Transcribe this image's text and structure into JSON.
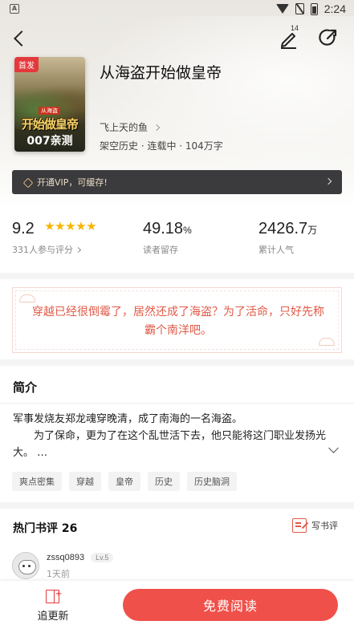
{
  "status_bar": {
    "time": "2:24",
    "left_icon_letter": "A"
  },
  "nav": {
    "edit_count": "14"
  },
  "book": {
    "badge": "首发",
    "cover_subtitle": "从海盗",
    "cover_title": "开始做皇帝",
    "cover_tag": "007亲测",
    "title": "从海盗开始做皇帝",
    "author": "飞上天的鱼",
    "meta": "架空历史 · 连载中 · 104万字"
  },
  "vip": {
    "text": "开通VIP，可缓存!"
  },
  "stats": {
    "rating": "9.2",
    "rating_stars": 4.5,
    "rating_label": "331人参与评分",
    "retention": "49.18",
    "retention_unit": "%",
    "retention_label": "读者留存",
    "popularity": "2426.7",
    "popularity_unit": "万",
    "popularity_label": "累计人气"
  },
  "quote": "穿越已经很倒霉了，居然还成了海盗？为了活命，只好先称霸个南洋吧。",
  "intro": {
    "heading": "简介",
    "line1": "军事发烧友郑龙魂穿晚清，成了南海的一名海盗。",
    "line2": "为了保命，更为了在这个乱世活下去，他只能将这门职业发扬光大。 …",
    "tags": [
      "爽点密集",
      "穿越",
      "皇帝",
      "历史",
      "历史脑洞"
    ]
  },
  "reviews": {
    "heading": "热门书评 26",
    "write_label": "写书评",
    "first": {
      "user": "zssq0893",
      "level": "Lv.5",
      "time": "1天前"
    }
  },
  "bottom": {
    "follow_label": "追更新",
    "read_label": "免费阅读"
  },
  "colors": {
    "accent": "#f0504a",
    "quote_text": "#e05a47",
    "vip_bg": "#3b3a3d",
    "star": "#f7b500"
  }
}
